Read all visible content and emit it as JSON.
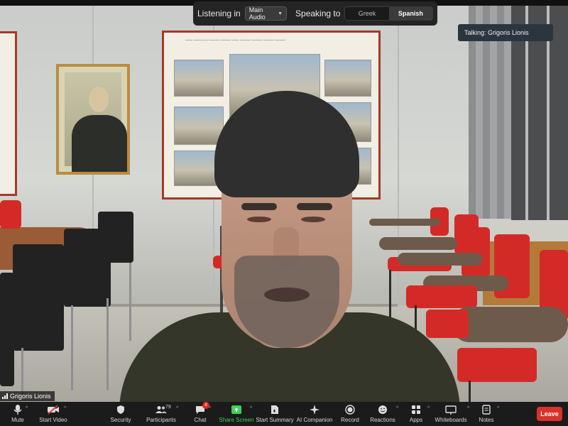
{
  "interpretation": {
    "listening_label": "Listening in",
    "audio_select_value": "Main Audio",
    "speaking_label": "Speaking to",
    "languages": [
      "Greek",
      "Spanish"
    ],
    "active_language": "Spanish"
  },
  "talking_indicator": "Talking: Grigoris Lionis",
  "participant_name": "Grigoris Lionis",
  "toolbar": {
    "mute": "Mute",
    "start_video": "Start Video",
    "security": "Security",
    "participants": "Participants",
    "participants_count": "79",
    "chat": "Chat",
    "chat_badge": "8",
    "share_screen": "Share Screen",
    "start_summary": "Start Summary",
    "ai_companion": "AI Companion",
    "record": "Record",
    "reactions": "Reactions",
    "apps": "Apps",
    "whiteboards": "Whiteboards",
    "notes": "Notes",
    "leave": "Leave"
  },
  "colors": {
    "toolbar_bg": "#1b1b1b",
    "leave_red": "#d9322b",
    "share_green": "#3ecf5a",
    "talking_bg": "#2b3540"
  }
}
